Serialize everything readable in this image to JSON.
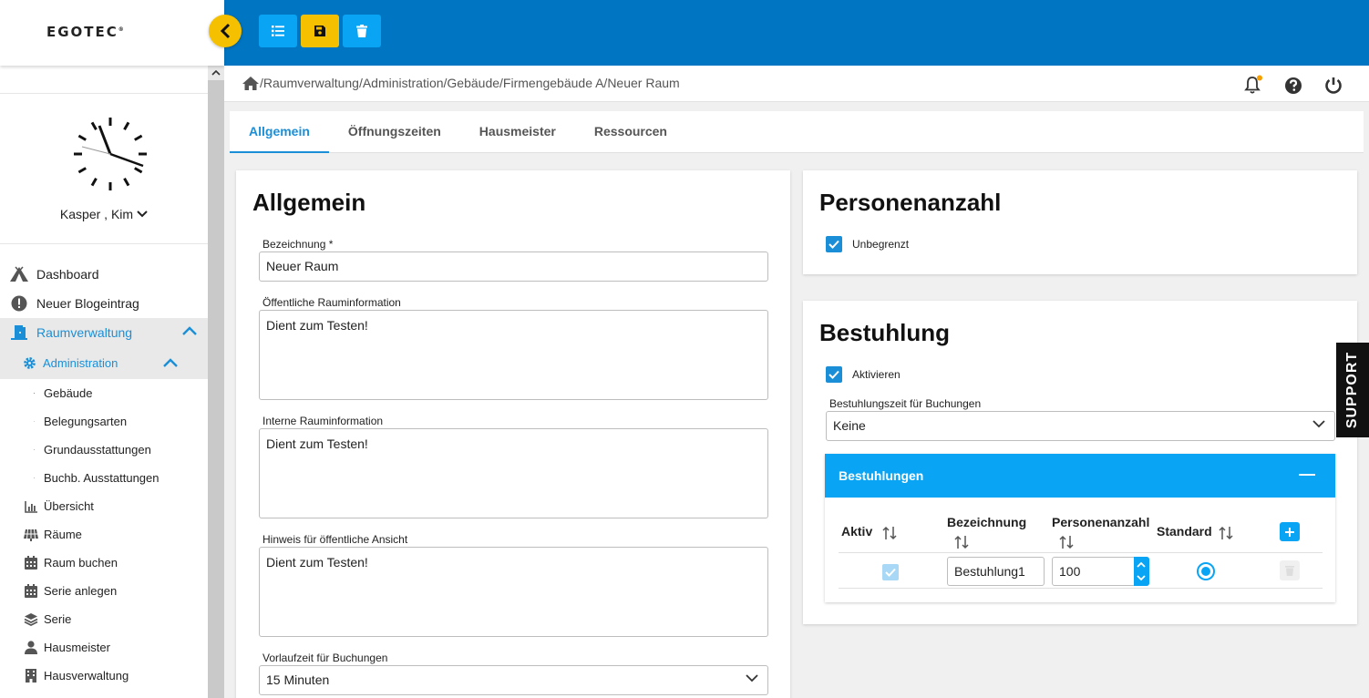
{
  "app": {
    "logo": "EGOTEC",
    "logo_mark": "®"
  },
  "user": {
    "name": "Kasper , Kim"
  },
  "nav": {
    "items": [
      {
        "label": "Dashboard",
        "icon": "tent-icon"
      },
      {
        "label": "Neuer Blogeintrag",
        "icon": "exclamation-icon"
      },
      {
        "label": "Raumverwaltung",
        "icon": "door-icon"
      }
    ],
    "admin": {
      "label": "Administration",
      "icon": "gear-icon"
    },
    "admin_children": [
      {
        "label": "Gebäude",
        "icon": "building-icon"
      },
      {
        "label": "Belegungsarten",
        "icon": "list-icon"
      },
      {
        "label": "Grundausstattungen",
        "icon": "laptop-icon"
      },
      {
        "label": "Buchb. Ausstattungen",
        "icon": "monitor-plus-icon"
      }
    ],
    "room_children": [
      {
        "label": "Übersicht",
        "icon": "chart-icon"
      },
      {
        "label": "Räume",
        "icon": "solar-icon"
      },
      {
        "label": "Raum buchen",
        "icon": "calendar-icon"
      },
      {
        "label": "Serie anlegen",
        "icon": "calendar-icon"
      },
      {
        "label": "Serie",
        "icon": "layers-icon"
      },
      {
        "label": "Hausmeister",
        "icon": "person-icon"
      },
      {
        "label": "Hausverwaltung",
        "icon": "building-icon"
      }
    ]
  },
  "breadcrumb": "/Raumverwaltung/Administration/Gebäude/Firmengebäude A/Neuer Raum",
  "tabs": [
    "Allgemein",
    "Öffnungszeiten",
    "Hausmeister",
    "Ressourcen"
  ],
  "general": {
    "title": "Allgemein",
    "bezeichnung_label": "Bezeichnung *",
    "bezeichnung_value": "Neuer Raum",
    "public_info_label": "Öffentliche Rauminformation",
    "public_info_value": "Dient zum Testen!",
    "internal_info_label": "Interne Rauminformation",
    "internal_info_value": "Dient zum Testen!",
    "hint_label": "Hinweis für öffentliche Ansicht",
    "hint_value": "Dient zum Testen!",
    "lead_time_label": "Vorlaufzeit für Buchungen",
    "lead_time_value": "15 Minuten"
  },
  "persons": {
    "title": "Personenanzahl",
    "unlimited_label": "Unbegrenzt"
  },
  "seating": {
    "title": "Bestuhlung",
    "activate_label": "Aktivieren",
    "time_label": "Bestuhlungszeit für Buchungen",
    "time_value": "Keine",
    "panel_title": "Bestuhlungen",
    "collapse_symbol": "—",
    "headers": {
      "aktiv": "Aktiv",
      "bezeichnung": "Bezeichnung",
      "personen": "Personenanzahl",
      "standard": "Standard"
    },
    "row": {
      "bezeichnung": "Bestuhlung1",
      "personen": "100"
    }
  },
  "support_label": "SUPPORT",
  "colors": {
    "primary": "#0075c2",
    "accent": "#1a8fd8",
    "panel_header": "#0aa4f5",
    "yellow": "#f5c000"
  }
}
